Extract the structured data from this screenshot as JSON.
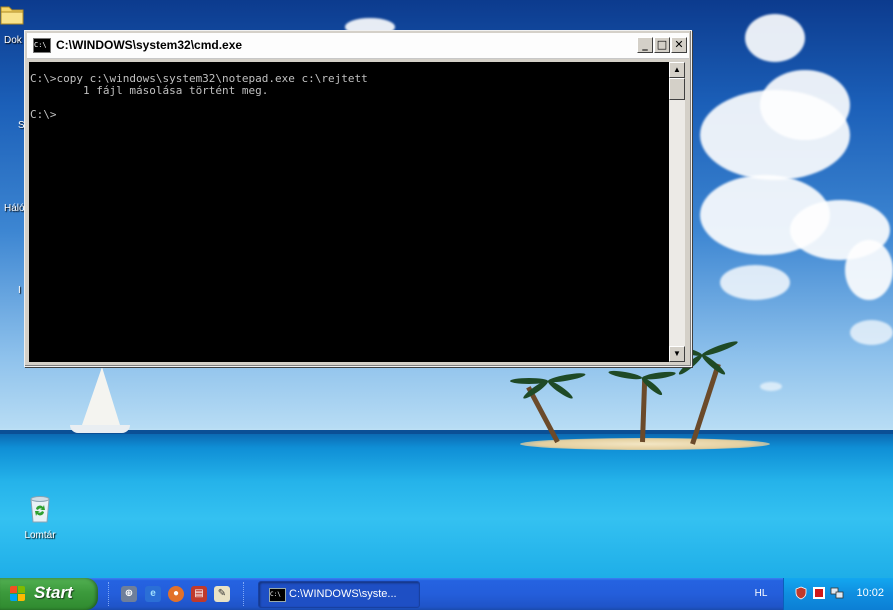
{
  "desktop": {
    "icons": [
      {
        "label": "Dok"
      },
      {
        "label": "S"
      },
      {
        "label": "Háló"
      },
      {
        "label": "I"
      },
      {
        "label": "Lomtár"
      }
    ]
  },
  "cmd_window": {
    "title": "C:\\WINDOWS\\system32\\cmd.exe",
    "icon_text": "C:\\",
    "minimize": "_",
    "maximize": "□",
    "close": "✕",
    "lines": [
      "C:\\>copy c:\\windows\\system32\\notepad.exe c:\\rejtett",
      "        1 fájl másolása történt meg.",
      "",
      "C:\\>"
    ]
  },
  "taskbar": {
    "start_label": "Start",
    "quick_launch": [
      "network-icon",
      "ie-icon",
      "firefox-icon",
      "save-icon",
      "notepad-icon"
    ],
    "task_button_label": "C:\\WINDOWS\\syste...",
    "task_button_icon_text": "C:\\",
    "language": "HL",
    "clock": "10:02"
  },
  "colors": {
    "taskbar": "#245edb",
    "start": "#3c9a3c",
    "tray": "#0f8ee0",
    "console_bg": "#000000",
    "console_fg": "#c0c0c0"
  }
}
